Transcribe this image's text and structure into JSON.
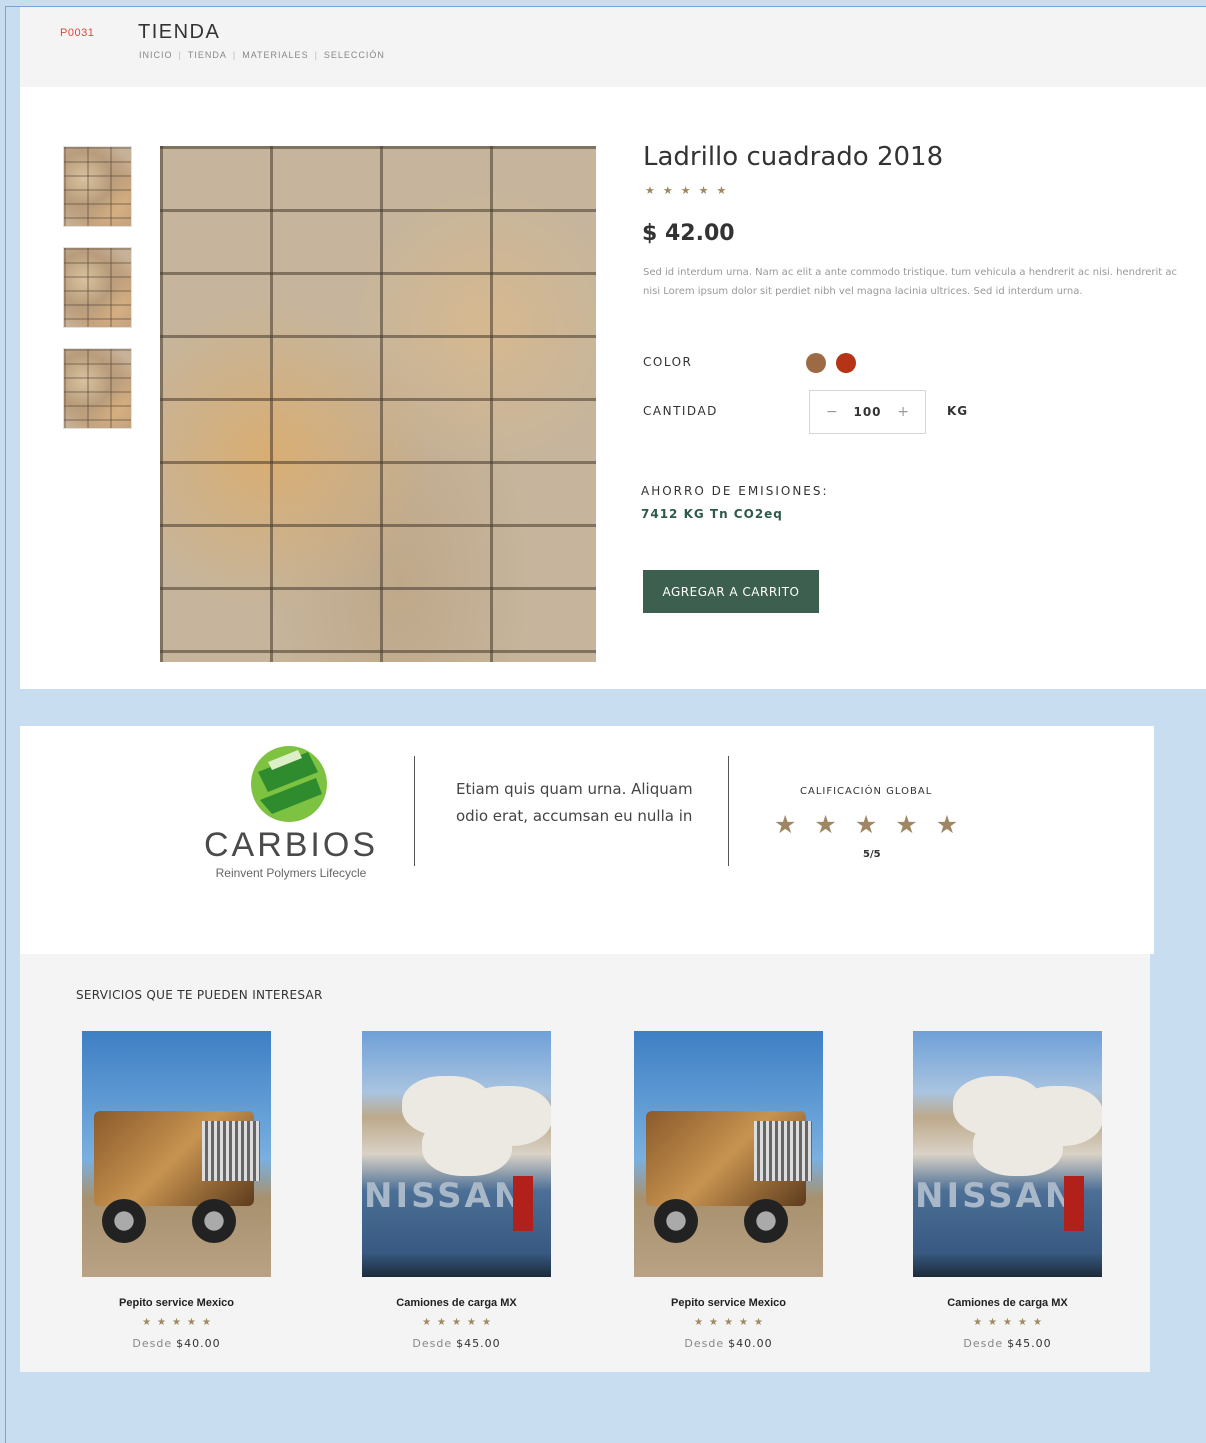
{
  "header": {
    "code": "P0031",
    "title": "TIENDA",
    "breadcrumb": [
      "INICIO",
      "TIENDA",
      "MATERIALES",
      "SELECCIÓN"
    ],
    "separator": "|"
  },
  "product": {
    "title": "Ladrillo cuadrado 2018",
    "rating_stars": 5,
    "star_glyph": "★",
    "price": "$ 42.00",
    "description": "Sed id interdum urna. Nam ac elit a ante commodo tristique. tum vehicula a hendrerit ac nisi. hendrerit ac nisi Lorem ipsum dolor sit perdiet nibh vel magna lacinia ultrices. Sed id interdum urna.",
    "color_label": "COLOR",
    "colors": [
      "#9c6a45",
      "#b63415"
    ],
    "quantity_label": "CANTIDAD",
    "quantity": {
      "minus": "−",
      "value": "100",
      "plus": "+"
    },
    "unit": "KG",
    "emissions_label": "AHORRO DE EMISIONES:",
    "emissions_value": "7412 KG Tn CO2eq",
    "add_to_cart": "AGREGAR A CARRITO"
  },
  "seller": {
    "name": "CARBIOS",
    "tagline": "Reinvent Polymers Lifecycle",
    "description": "Etiam quis quam urna. Aliquam odio erat, accumsan eu nulla in",
    "rating_label": "CALIFICACIÓN GLOBAL",
    "rating_value": "5/5",
    "logo_colors": [
      "#2e8b2e",
      "#7ec242"
    ]
  },
  "services": {
    "title": "SERVICIOS QUE TE PUEDEN INTERESAR",
    "price_prefix": "Desde",
    "items": [
      {
        "name": "Pepito service Mexico",
        "price": "$40.00",
        "image": "dump-truck"
      },
      {
        "name": "Camiones de carga MX",
        "price": "$45.00",
        "image": "pickup-truck",
        "brand_text": "NISSAN"
      },
      {
        "name": "Pepito service Mexico",
        "price": "$40.00",
        "image": "dump-truck"
      },
      {
        "name": "Camiones de carga MX",
        "price": "$45.00",
        "image": "pickup-truck",
        "brand_text": "NISSAN"
      }
    ]
  },
  "colors": {
    "accent_button": "#3d5f50",
    "star": "#a08763",
    "code_red": "#e0453a",
    "page_bg": "#c9ddf1"
  }
}
